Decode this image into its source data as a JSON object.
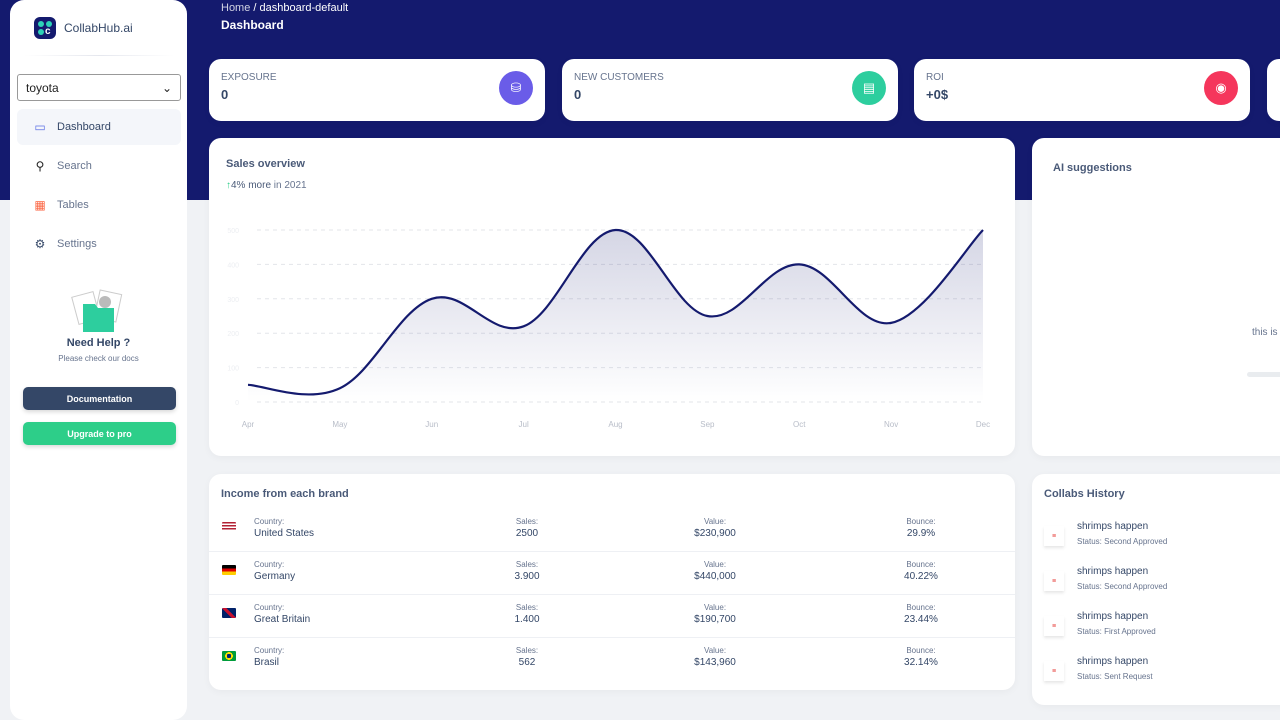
{
  "app": {
    "name": "CollabHub.ai"
  },
  "sidebar": {
    "brand_select": "toyota",
    "items": [
      {
        "label": "Dashboard",
        "icon": "monitor-icon",
        "active": true
      },
      {
        "label": "Search",
        "icon": "search-icon"
      },
      {
        "label": "Tables",
        "icon": "calendar-icon"
      },
      {
        "label": "Settings",
        "icon": "gear-icon"
      }
    ],
    "help_title": "Need Help ?",
    "help_sub": "Please check our docs",
    "documentation": "Documentation",
    "upgrade": "Upgrade to pro"
  },
  "header": {
    "breadcrumb_home": "Home",
    "breadcrumb_sep": "/",
    "breadcrumb_current": "dashboard-default",
    "title": "Dashboard"
  },
  "stats": [
    {
      "label": "EXPOSURE",
      "value": "0",
      "icon": "database-icon",
      "color": "#6a5ce8"
    },
    {
      "label": "NEW CUSTOMERS",
      "value": "0",
      "icon": "document-icon",
      "color": "#2dce9e"
    },
    {
      "label": "ROI",
      "value": "+0$",
      "icon": "globe-icon",
      "color": "#f5365c"
    }
  ],
  "sales": {
    "title": "Sales overview",
    "trend_value": "4% more",
    "trend_suffix": " in 2021"
  },
  "chart_data": {
    "type": "line",
    "categories": [
      "Apr",
      "May",
      "Jun",
      "Jul",
      "Aug",
      "Sep",
      "Oct",
      "Nov",
      "Dec"
    ],
    "values": [
      50,
      40,
      300,
      220,
      500,
      250,
      400,
      230,
      500
    ],
    "ylim": [
      0,
      500
    ],
    "yticks": [
      0,
      100,
      200,
      300,
      400,
      500
    ],
    "grid": true,
    "line_color": "#141a6e"
  },
  "ai": {
    "title": "AI suggestions",
    "text": "this is"
  },
  "income": {
    "title": "Income from each brand",
    "labels": {
      "country": "Country:",
      "sales": "Sales:",
      "value": "Value:",
      "bounce": "Bounce:"
    },
    "rows": [
      {
        "country": "United States",
        "sales": "2500",
        "value": "$230,900",
        "bounce": "29.9%",
        "flag": "us"
      },
      {
        "country": "Germany",
        "sales": "3.900",
        "value": "$440,000",
        "bounce": "40.22%",
        "flag": "de"
      },
      {
        "country": "Great Britain",
        "sales": "1.400",
        "value": "$190,700",
        "bounce": "23.44%",
        "flag": "gb"
      },
      {
        "country": "Brasil",
        "sales": "562",
        "value": "$143,960",
        "bounce": "32.14%",
        "flag": "br"
      }
    ]
  },
  "collabs": {
    "title": "Collabs History",
    "items": [
      {
        "name": "shrimps happen",
        "status": "Status: Second Approved"
      },
      {
        "name": "shrimps happen",
        "status": "Status: Second Approved"
      },
      {
        "name": "shrimps happen",
        "status": "Status: First Approved"
      },
      {
        "name": "shrimps happen",
        "status": "Status: Sent Request"
      }
    ]
  }
}
